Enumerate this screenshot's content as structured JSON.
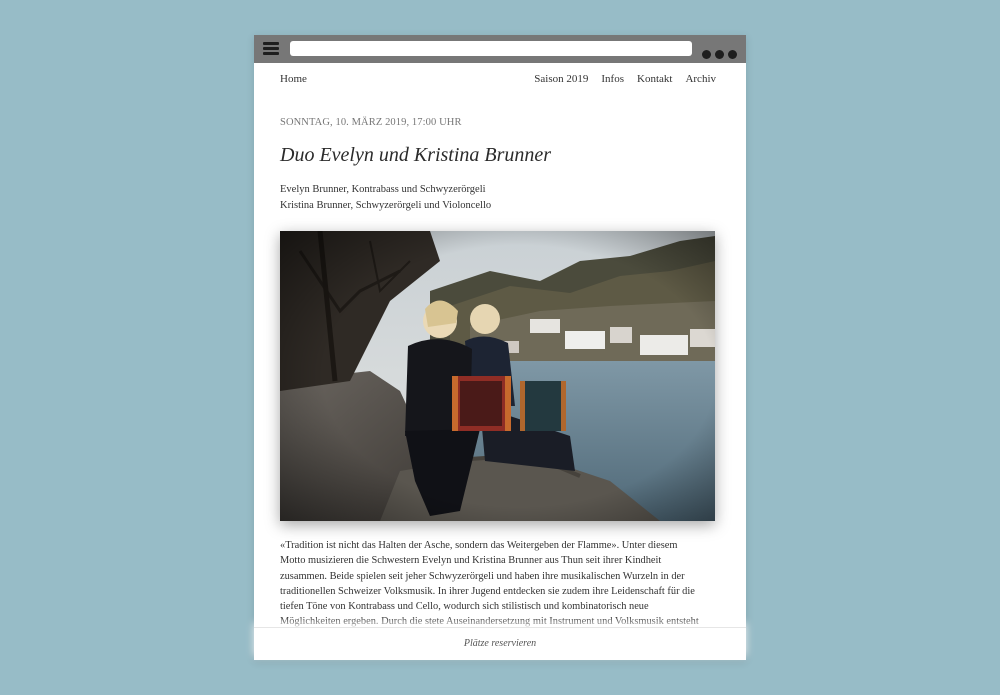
{
  "browser": {
    "menu_icon": "hamburger-menu-icon",
    "more_icon": "more-dots-icon",
    "chrome_color": "#777777"
  },
  "nav": {
    "home": "Home",
    "links": [
      "Saison 2019",
      "Infos",
      "Kontakt",
      "Archiv"
    ]
  },
  "event": {
    "date": "SONNTAG, 10. MÄRZ 2019, 17:00 UHR",
    "title": "Duo Evelyn und Kristina Brunner",
    "performers": [
      "Evelyn Brunner, Kontrabass und Schwyzerörgeli",
      "Kristina Brunner, Schwyzerörgeli und Violoncello"
    ],
    "description_lines": [
      "«Tradition ist nicht das Halten der Asche, sondern das Weitergeben der Flamme». Unter diesem",
      "Motto musizieren die Schwestern Evelyn und Kristina Brunner aus Thun seit ihrer Kindheit",
      "zusammen. Beide spielen seit jeher Schwyzerörgeli und haben ihre musikalischen Wurzeln in der",
      "traditionellen Schweizer Volksmusik. In ihrer Jugend entdecken sie zudem ihre Leidenschaft für die",
      "tiefen Töne von Kontrabass und Cello, wodurch sich stilistisch und kombinatorisch neue",
      "Möglichkeiten ergeben. Durch die stete Auseinandersetzung mit Instrument und Volksmusik entsteht"
    ]
  },
  "footer": {
    "reserve": "Plätze reservieren"
  },
  "colors": {
    "background": "#97bcc7",
    "page": "#ffffff",
    "text": "#333333"
  }
}
